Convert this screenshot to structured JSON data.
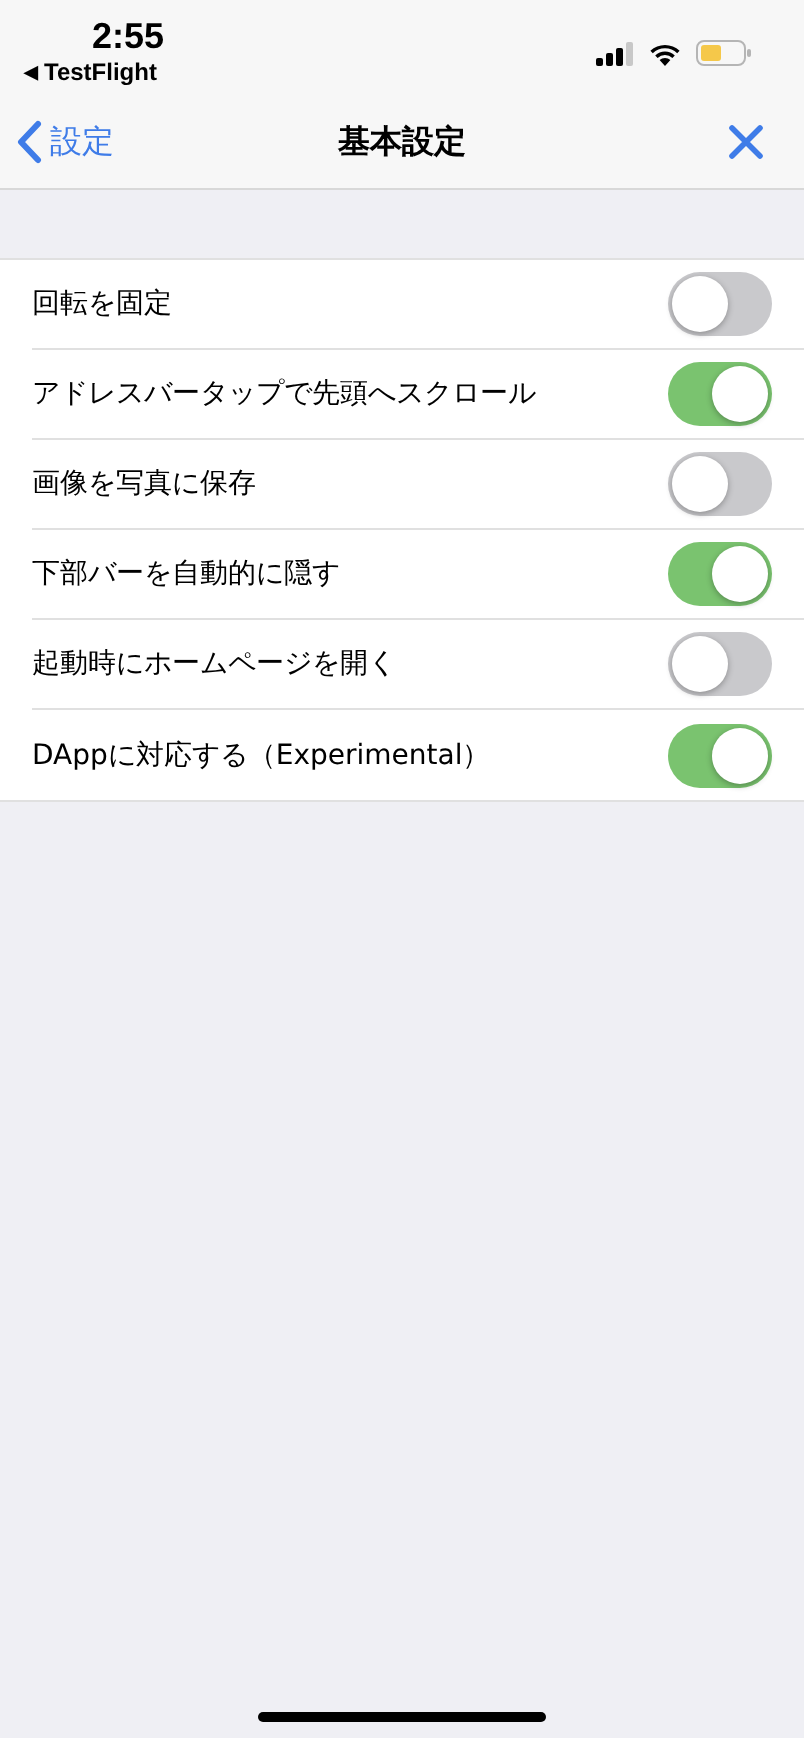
{
  "status_bar": {
    "time": "2:55",
    "back_app": {
      "arrow": "◀",
      "label": "TestFlight"
    }
  },
  "nav": {
    "back_label": "設定",
    "title": "基本設定"
  },
  "settings": [
    {
      "label": "回転を固定",
      "on": false
    },
    {
      "label": "アドレスバータップで先頭へスクロール",
      "on": true
    },
    {
      "label": "画像を写真に保存",
      "on": false
    },
    {
      "label": "下部バーを自動的に隠す",
      "on": true
    },
    {
      "label": "起動時にホームページを開く",
      "on": false
    },
    {
      "label": "DAppに対応する（Experimental）",
      "on": true
    }
  ]
}
